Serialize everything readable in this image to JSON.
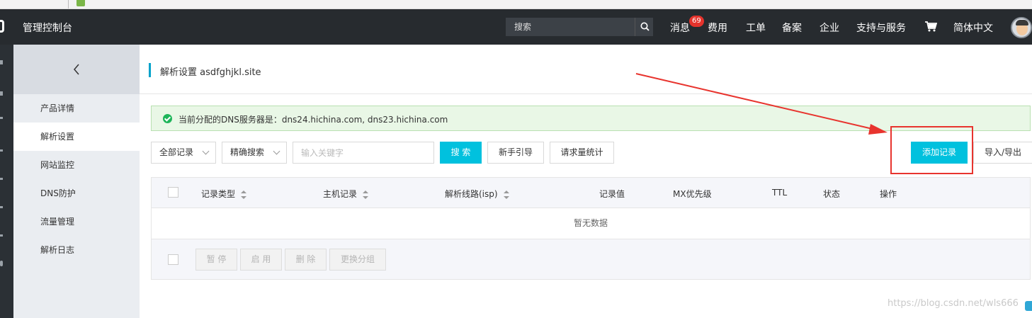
{
  "topbar": {
    "console_title": "管理控制台",
    "search_placeholder": "搜索",
    "nav": [
      "消息",
      "费用",
      "工单",
      "备案",
      "企业",
      "支持与服务",
      "简体中文"
    ],
    "message_count": "69"
  },
  "sidebar": {
    "items": [
      "产品详情",
      "解析设置",
      "网站监控",
      "DNS防护",
      "流量管理",
      "解析日志"
    ],
    "active_index": 1
  },
  "page": {
    "title": "解析设置 asdfghjkl.site",
    "notice": "当前分配的DNS服务器是：dns24.hichina.com, dns23.hichina.com"
  },
  "toolbar": {
    "record_filter": "全部记录",
    "search_mode": "精确搜索",
    "keyword_placeholder": "输入关键字",
    "search_label": "搜 索",
    "guide_label": "新手引导",
    "stats_label": "请求量统计",
    "add_label": "添加记录",
    "import_export_label": "导入/导出"
  },
  "table": {
    "headers": [
      "记录类型",
      "主机记录",
      "解析线路(isp)",
      "记录值",
      "MX优先级",
      "TTL",
      "状态",
      "操作"
    ],
    "empty_text": "暂无数据",
    "bulk_actions": [
      "暂 停",
      "启 用",
      "删 除",
      "更换分组"
    ]
  },
  "watermark": "https://blog.csdn.net/wls666",
  "colors": {
    "topbar_bg": "#272b2f",
    "primary": "#00c1de",
    "accent": "#00a2ca",
    "highlight": "#e8342e",
    "notice_bg": "#e9f7e6"
  }
}
